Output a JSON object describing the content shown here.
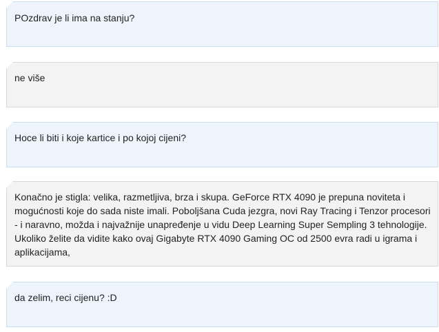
{
  "messages": [
    {
      "role": "question",
      "text": "POzdrav je li ima na stanju?"
    },
    {
      "role": "answer",
      "text": "ne više"
    },
    {
      "role": "question",
      "text": "Hoce li biti i koje kartice i po kojoj cijeni?"
    },
    {
      "role": "answer",
      "text": "Konačno je stigla: velika, razmetljiva, brza i skupa. GeForce RTX 4090 je prepuna noviteta i mogućnosti koje do sada niste imali. Poboljšana Cuda jezgra, novi Ray Tracing i Tenzor procesori - i naravno, možda i najvažnije unapređenje u vidu Deep Learning Super Sempling 3 tehnologije. Ukoliko želite da vidite kako ovaj Gigabyte RTX 4090 Gaming OC od 2500 evra radi u igrama i aplikacijama,"
    },
    {
      "role": "question",
      "text": "da zelim, reci cijenu? :D"
    }
  ],
  "colors": {
    "question_bg": "#eef4fb",
    "answer_bg": "#f3f3f3",
    "text": "#222222"
  }
}
